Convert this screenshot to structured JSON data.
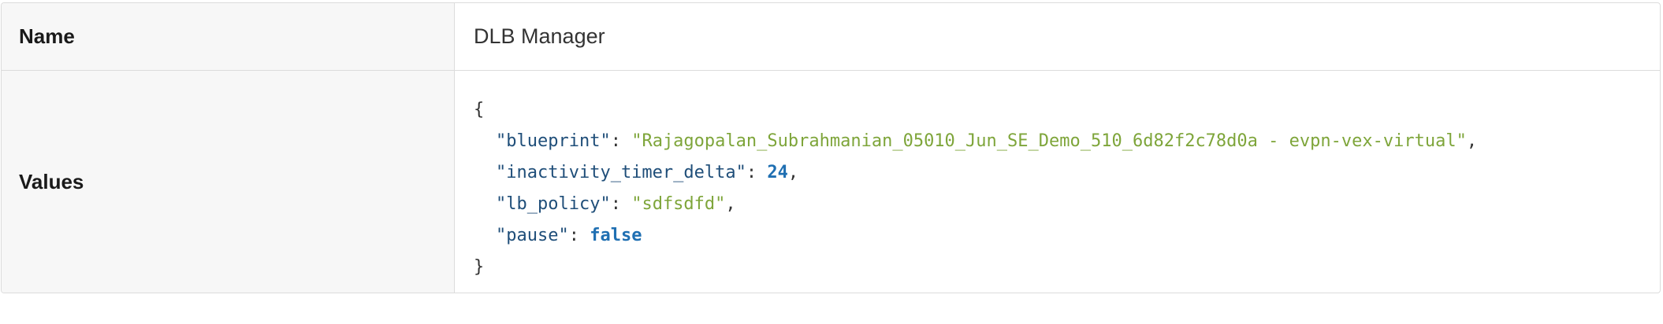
{
  "rows": {
    "name": {
      "label": "Name",
      "value": "DLB Manager"
    },
    "values": {
      "label": "Values",
      "json": {
        "open_brace": "{",
        "close_brace": "}",
        "entries": [
          {
            "key": "\"blueprint\"",
            "value": "\"Rajagopalan_Subrahmanian_05010_Jun_SE_Demo_510_6d82f2c78d0a - evpn-vex-virtual\"",
            "value_type": "string",
            "trailing": ","
          },
          {
            "key": "\"inactivity_timer_delta\"",
            "value": "24",
            "value_type": "number",
            "trailing": ","
          },
          {
            "key": "\"lb_policy\"",
            "value": "\"sdfsdfd\"",
            "value_type": "string",
            "trailing": ","
          },
          {
            "key": "\"pause\"",
            "value": "false",
            "value_type": "boolean",
            "trailing": ""
          }
        ]
      }
    }
  },
  "colors": {
    "key": "#1f4e79",
    "string": "#7ea53a",
    "number": "#1f6fb2",
    "boolean": "#1f6fb2",
    "label_bg": "#f7f7f7",
    "border": "#dcdcdc"
  }
}
